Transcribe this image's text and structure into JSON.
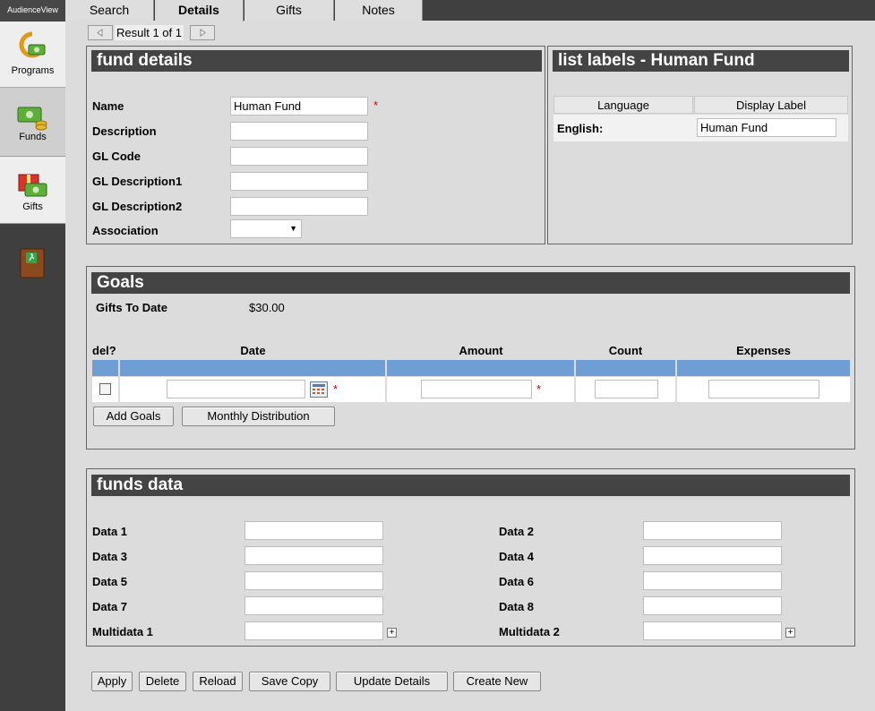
{
  "app": {
    "brand": "AudienceView"
  },
  "sidebar": {
    "programs_label": "Programs",
    "funds_label": "Funds",
    "gifts_label": "Gifts"
  },
  "tabs": [
    {
      "label": "Search"
    },
    {
      "label": "Details"
    },
    {
      "label": "Gifts"
    },
    {
      "label": "Notes"
    }
  ],
  "pager": {
    "label": "Result 1 of 1"
  },
  "fund_details": {
    "title": "fund details",
    "name_label": "Name",
    "name_value": "Human Fund",
    "description_label": "Description",
    "description_value": "",
    "gl_code_label": "GL Code",
    "gl_code_value": "",
    "gl_desc1_label": "GL Description1",
    "gl_desc1_value": "",
    "gl_desc2_label": "GL Description2",
    "gl_desc2_value": "",
    "association_label": "Association",
    "association_value": "",
    "required_mark": "*"
  },
  "list_labels": {
    "title": "list labels - Human Fund",
    "col_language": "Language",
    "col_display": "Display Label",
    "row_language": "English:",
    "row_display_value": "Human Fund"
  },
  "goals": {
    "title": "Goals",
    "gifts_to_date_label": "Gifts To Date",
    "gifts_to_date_value": "$30.00",
    "col_del": "del?",
    "col_date": "Date",
    "col_amount": "Amount",
    "col_count": "Count",
    "col_expenses": "Expenses",
    "add_goals_label": "Add Goals",
    "monthly_distribution_label": "Monthly Distribution"
  },
  "funds_data": {
    "title": "funds data",
    "left": [
      {
        "label": "Data 1",
        "value": ""
      },
      {
        "label": "Data 3",
        "value": ""
      },
      {
        "label": "Data 5",
        "value": ""
      },
      {
        "label": "Data 7",
        "value": ""
      },
      {
        "label": "Multidata 1",
        "value": ""
      }
    ],
    "right": [
      {
        "label": "Data 2",
        "value": ""
      },
      {
        "label": "Data 4",
        "value": ""
      },
      {
        "label": "Data 6",
        "value": ""
      },
      {
        "label": "Data 8",
        "value": ""
      },
      {
        "label": "Multidata 2",
        "value": ""
      }
    ]
  },
  "actions": {
    "apply": "Apply",
    "delete": "Delete",
    "reload": "Reload",
    "save_copy": "Save Copy",
    "update_details": "Update Details",
    "create_new": "Create New"
  },
  "icons": {
    "programs": "programs-icon",
    "funds": "funds-icon",
    "gifts": "gifts-icon",
    "exit": "exit-door-icon",
    "calendar": "calendar-icon",
    "prev": "prev-arrow-icon",
    "next": "next-arrow-icon",
    "expand": "expand-plus-icon"
  },
  "colors": {
    "header_bg": "#444444",
    "table_header_bar": "#6f9ed4",
    "required": "#d00000"
  }
}
